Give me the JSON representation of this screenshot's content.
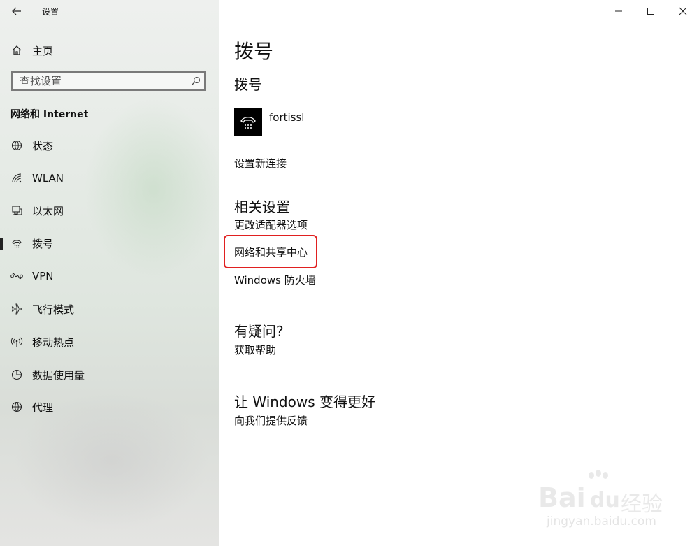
{
  "window": {
    "app_title": "设置",
    "controls": {
      "minimize": "minimize-icon",
      "maximize": "maximize-icon",
      "close": "close-icon"
    }
  },
  "sidebar": {
    "home_label": "主页",
    "search_placeholder": "查找设置",
    "section_header": "网络和 Internet",
    "items": [
      {
        "label": "状态",
        "icon": "globe-status-icon",
        "active": false
      },
      {
        "label": "WLAN",
        "icon": "wifi-icon",
        "active": false
      },
      {
        "label": "以太网",
        "icon": "ethernet-icon",
        "active": false
      },
      {
        "label": "拨号",
        "icon": "dialup-icon",
        "active": true
      },
      {
        "label": "VPN",
        "icon": "vpn-icon",
        "active": false
      },
      {
        "label": "飞行模式",
        "icon": "airplane-icon",
        "active": false
      },
      {
        "label": "移动热点",
        "icon": "hotspot-icon",
        "active": false
      },
      {
        "label": "数据使用量",
        "icon": "data-usage-icon",
        "active": false
      },
      {
        "label": "代理",
        "icon": "globe-proxy-icon",
        "active": false
      }
    ]
  },
  "main": {
    "page_title": "拨号",
    "dialup_section_title": "拨号",
    "connection_name": "fortissl",
    "new_connection_link": "设置新连接",
    "related_settings_title": "相关设置",
    "related_links": [
      "更改适配器选项",
      "网络和共享中心",
      "Windows 防火墙"
    ],
    "help_title": "有疑问?",
    "help_link": "获取帮助",
    "feedback_title": "让 Windows 变得更好",
    "feedback_link": "向我们提供反馈"
  },
  "watermark": {
    "brand": "Bai",
    "brand_suffix": "du",
    "brand_cn": "经验",
    "url": "jingyan.baidu.com"
  },
  "colors": {
    "highlight": "#e02020",
    "sidebar_bg": "#e6ebe6"
  }
}
